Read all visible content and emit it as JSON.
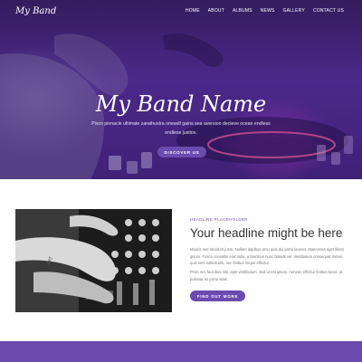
{
  "nav": {
    "logo": "My Band",
    "links": [
      "HOME",
      "ABOUT",
      "ALBUMS",
      "NEWS",
      "GALLERY",
      "CONTACT US"
    ]
  },
  "hero": {
    "title": "My Band Name",
    "subtitle": "Pisco pinnacle ultimate zarathustra oneself gains sea aversion decieve ocean endless endless justice.",
    "button": "DISCOVER US"
  },
  "feature": {
    "eyebrow": "HEADLINE PLACEHOLDER",
    "title": "Your headline might be here",
    "paragraph1": "Mauris sed tincidunt justo. Nullam dapibus arcu quis dui porta laoreet. Maecenas eget libero ipsum. Fusce convallis erat nulla, a faucibus nunc blandit vel. Vestibulum consequat metus quis sem sollicitudin, nec finibus neque efficitur.",
    "paragraph2": "Proin nec faucibus nisl, eget vestibulum. Sed ut est ipsum. Aenean efficitur finibus lacus, ut pulvinar ex porta vitae.",
    "button": "FIND OUT MORE"
  },
  "colors": {
    "accent": "#6b4bb0",
    "footer": "#6a4aac"
  }
}
